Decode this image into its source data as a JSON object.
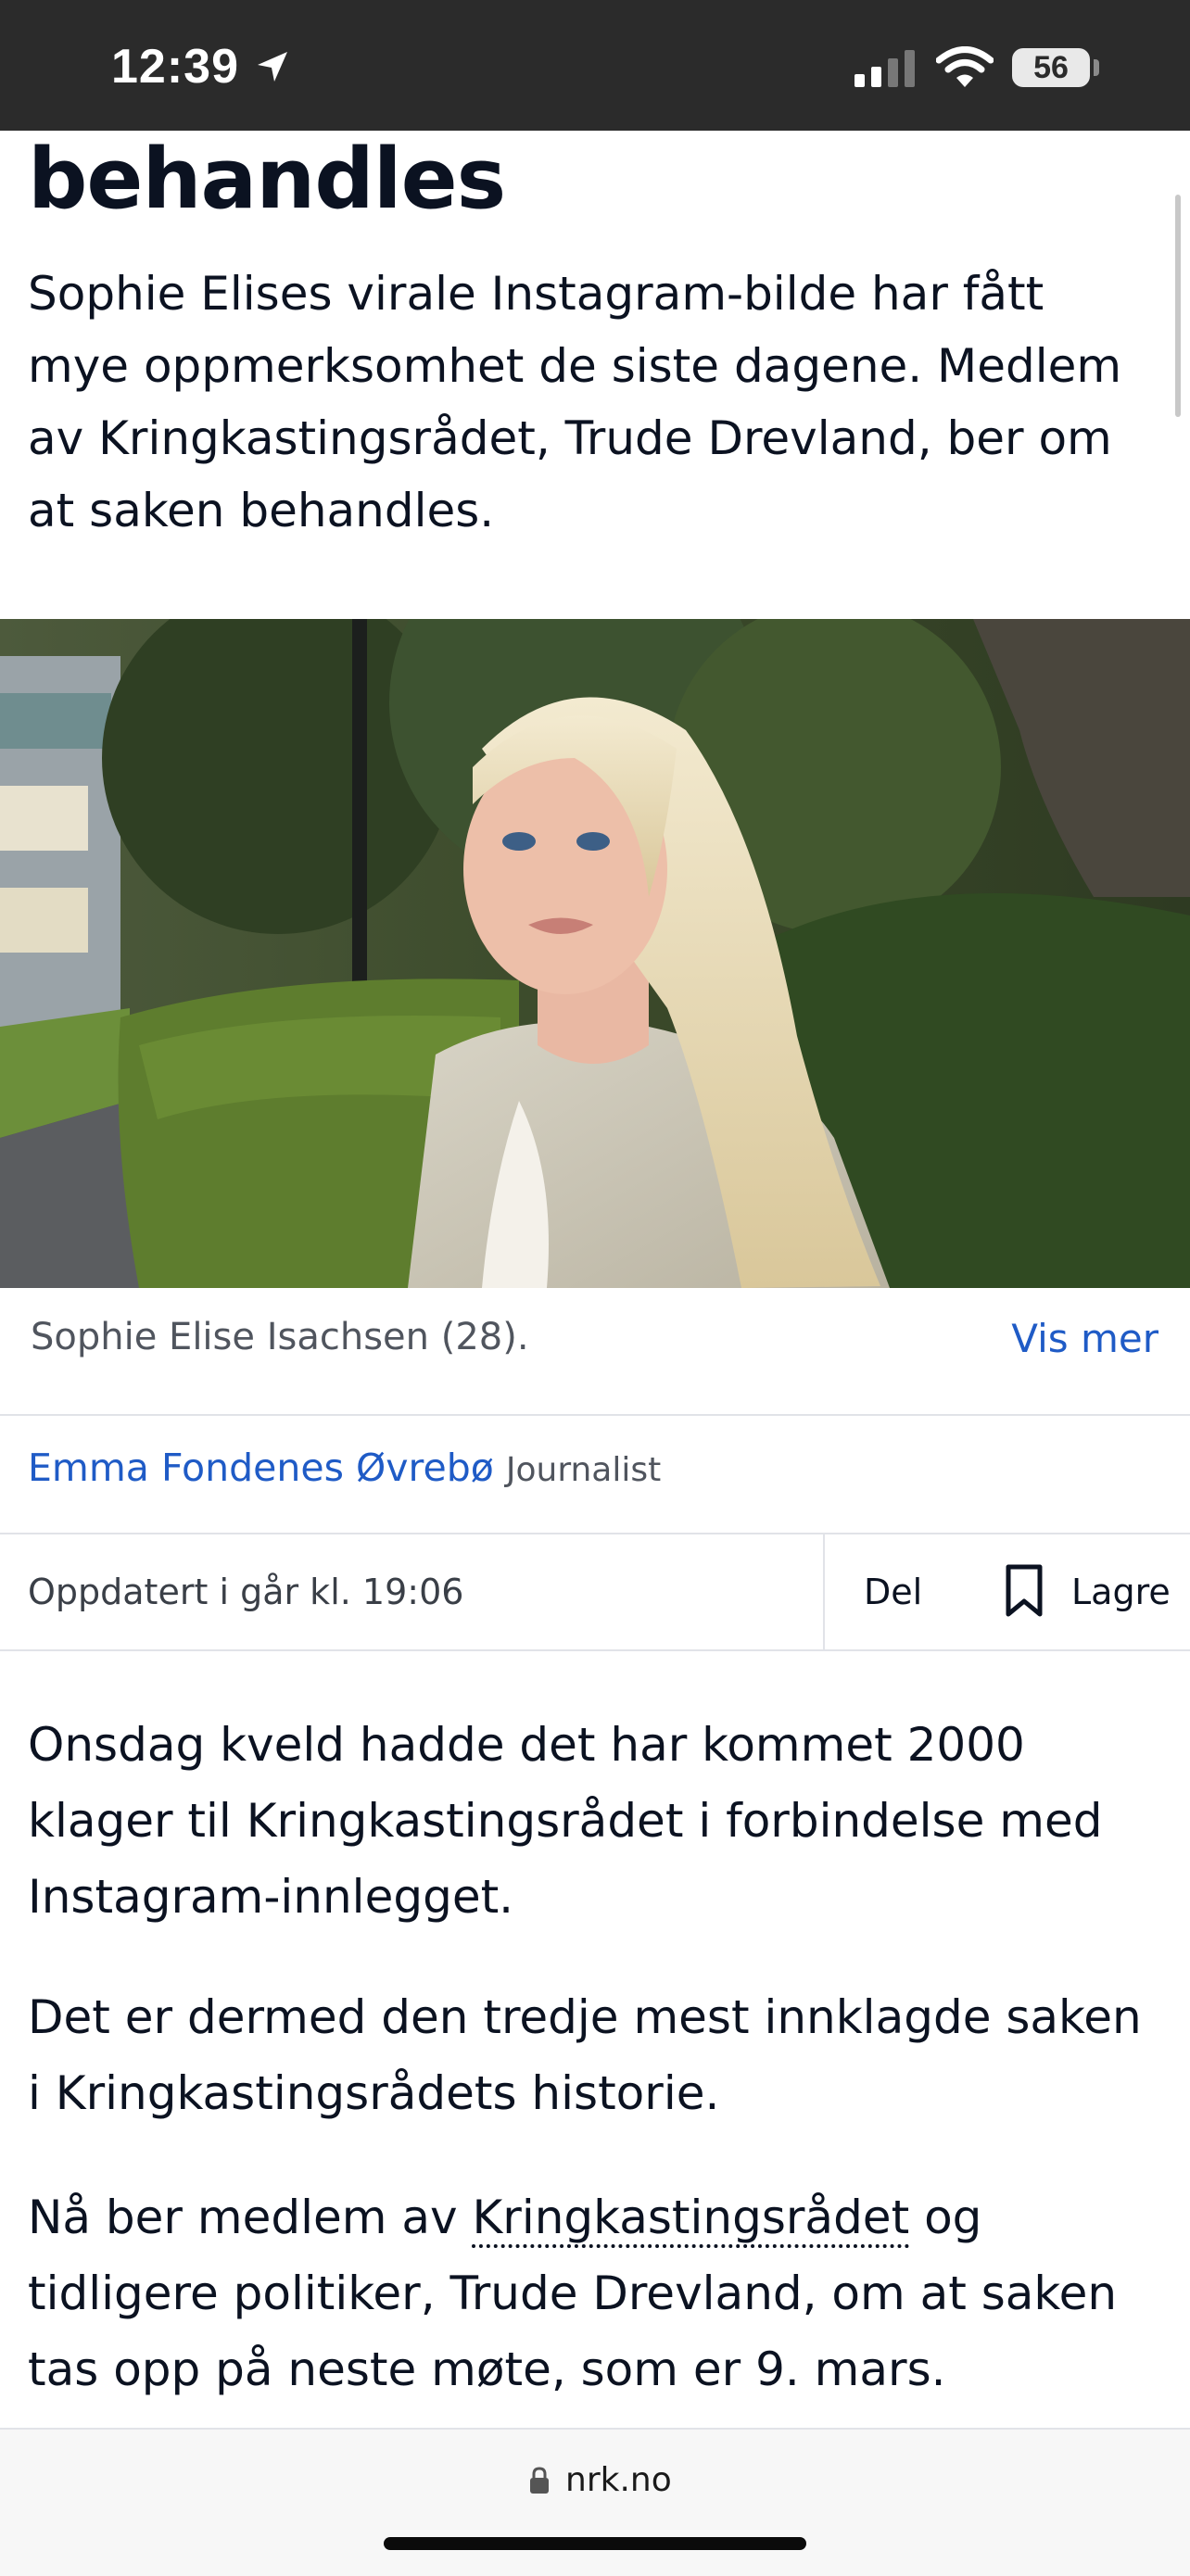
{
  "status_bar": {
    "time": "12:39",
    "battery": "56",
    "icons": [
      "location-arrow-icon",
      "cellular-signal-icon",
      "wifi-icon",
      "battery-icon"
    ]
  },
  "article": {
    "headline_fragment": "behandles",
    "lead": "Sophie Elises virale Instagram-bilde har fått mye oppmerksomhet de siste dagene. Medlem av Kringkastingsrådet, Trude Drevland, ber om at saken behandles.",
    "image_caption": "Sophie Elise Isachsen (28).",
    "show_more": "Vis mer",
    "byline": {
      "name": "Emma Fondenes Øvrebø",
      "role": "Journalist"
    },
    "updated": "Oppdatert i går kl. 19:06",
    "share_label": "Del",
    "save_label": "Lagre",
    "paragraphs": {
      "p1": "Onsdag kveld hadde det har kommet 2000 klager til Kringkastingsrådet i forbindelse med Instagram-innlegget.",
      "p2": "Det er dermed den tredje mest innklagde saken i Kringkastingsrådets historie.",
      "p3_before": "Nå ber medlem av ",
      "p3_term": "Kringkastingsrådet",
      "p3_after": " og tidligere politiker, Trude Drevland, om at saken tas opp på neste møte, som er 9. mars."
    }
  },
  "browser": {
    "domain": "nrk.no"
  },
  "colors": {
    "link": "#1f5bc6",
    "status_bar": "#2b2b2b",
    "text": "#0b1221"
  }
}
